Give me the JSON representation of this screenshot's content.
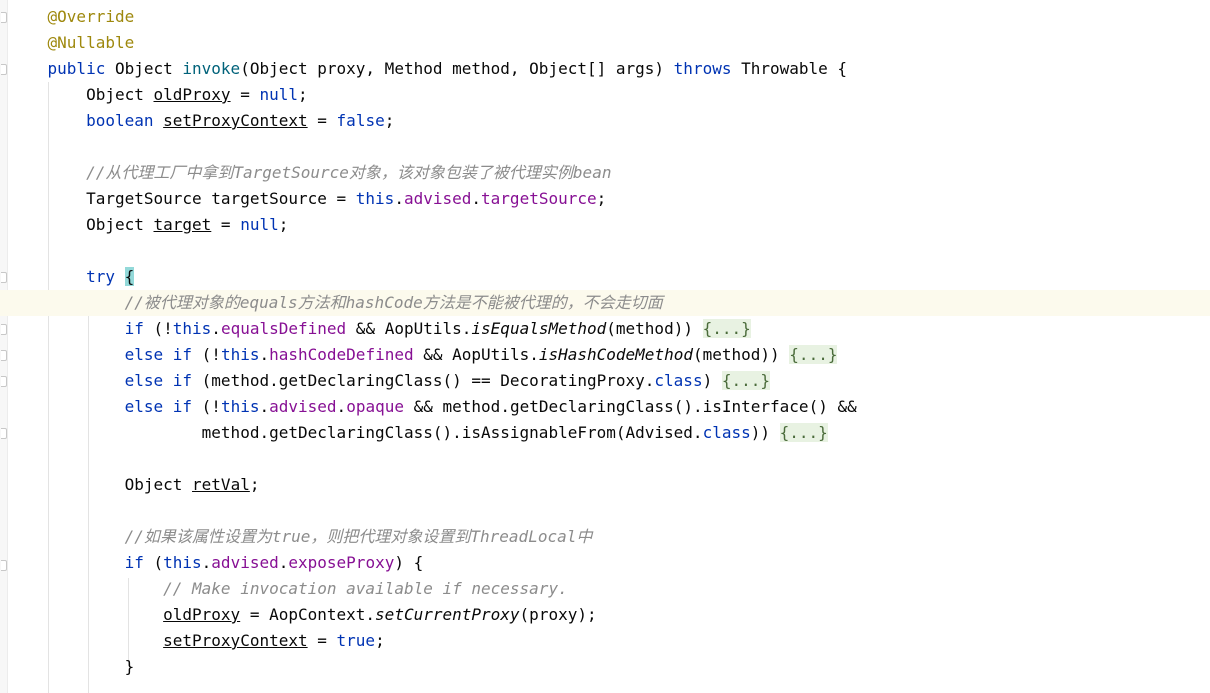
{
  "editor": {
    "lines": [
      [
        {
          "t": "    ",
          "c": ""
        },
        {
          "t": "@Override",
          "c": "ann"
        }
      ],
      [
        {
          "t": "    ",
          "c": ""
        },
        {
          "t": "@Nullable",
          "c": "ann"
        }
      ],
      [
        {
          "t": "    ",
          "c": ""
        },
        {
          "t": "public",
          "c": "kw"
        },
        {
          "t": " Object ",
          "c": ""
        },
        {
          "t": "invoke",
          "c": "fn"
        },
        {
          "t": "(Object proxy, Method method, Object[] args) ",
          "c": ""
        },
        {
          "t": "throws",
          "c": "kw"
        },
        {
          "t": " Throwable {",
          "c": ""
        }
      ],
      [
        {
          "t": "        Object ",
          "c": ""
        },
        {
          "t": "oldProxy",
          "c": "ul"
        },
        {
          "t": " = ",
          "c": ""
        },
        {
          "t": "null",
          "c": "kw"
        },
        {
          "t": ";",
          "c": ""
        }
      ],
      [
        {
          "t": "        ",
          "c": ""
        },
        {
          "t": "boolean",
          "c": "kw"
        },
        {
          "t": " ",
          "c": ""
        },
        {
          "t": "setProxyContext",
          "c": "ul"
        },
        {
          "t": " = ",
          "c": ""
        },
        {
          "t": "false",
          "c": "kw"
        },
        {
          "t": ";",
          "c": ""
        }
      ],
      [],
      [
        {
          "t": "        ",
          "c": ""
        },
        {
          "t": "//从代理工厂中拿到TargetSource对象，该对象包装了被代理实例bean",
          "c": "cm"
        }
      ],
      [
        {
          "t": "        TargetSource targetSource = ",
          "c": ""
        },
        {
          "t": "this",
          "c": "kw"
        },
        {
          "t": ".",
          "c": ""
        },
        {
          "t": "advised",
          "c": "fld"
        },
        {
          "t": ".",
          "c": ""
        },
        {
          "t": "targetSource",
          "c": "fld"
        },
        {
          "t": ";",
          "c": ""
        }
      ],
      [
        {
          "t": "        Object ",
          "c": ""
        },
        {
          "t": "target",
          "c": "ul"
        },
        {
          "t": " = ",
          "c": ""
        },
        {
          "t": "null",
          "c": "kw"
        },
        {
          "t": ";",
          "c": ""
        }
      ],
      [],
      [
        {
          "t": "        ",
          "c": ""
        },
        {
          "t": "try",
          "c": "kw"
        },
        {
          "t": " ",
          "c": ""
        },
        {
          "t": "{",
          "c": "brace-hl"
        }
      ],
      [
        {
          "t": "            ",
          "c": ""
        },
        {
          "t": "//被代理对象的equals方法和hashCode方法是不能被代理的，不会走切面",
          "c": "cm"
        }
      ],
      [
        {
          "t": "            ",
          "c": ""
        },
        {
          "t": "if",
          "c": "kw"
        },
        {
          "t": " (!",
          "c": ""
        },
        {
          "t": "this",
          "c": "kw"
        },
        {
          "t": ".",
          "c": ""
        },
        {
          "t": "equalsDefined",
          "c": "fld"
        },
        {
          "t": " && AopUtils.",
          "c": ""
        },
        {
          "t": "isEqualsMethod",
          "c": "st"
        },
        {
          "t": "(method)) ",
          "c": ""
        },
        {
          "t": "{...}",
          "c": "folded"
        }
      ],
      [
        {
          "t": "            ",
          "c": ""
        },
        {
          "t": "else if",
          "c": "kw"
        },
        {
          "t": " (!",
          "c": ""
        },
        {
          "t": "this",
          "c": "kw"
        },
        {
          "t": ".",
          "c": ""
        },
        {
          "t": "hashCodeDefined",
          "c": "fld"
        },
        {
          "t": " && AopUtils.",
          "c": ""
        },
        {
          "t": "isHashCodeMethod",
          "c": "st"
        },
        {
          "t": "(method)) ",
          "c": ""
        },
        {
          "t": "{...}",
          "c": "folded"
        }
      ],
      [
        {
          "t": "            ",
          "c": ""
        },
        {
          "t": "else if",
          "c": "kw"
        },
        {
          "t": " (method.getDeclaringClass() == DecoratingProxy.",
          "c": ""
        },
        {
          "t": "class",
          "c": "kw"
        },
        {
          "t": ") ",
          "c": ""
        },
        {
          "t": "{...}",
          "c": "folded"
        }
      ],
      [
        {
          "t": "            ",
          "c": ""
        },
        {
          "t": "else if",
          "c": "kw"
        },
        {
          "t": " (!",
          "c": ""
        },
        {
          "t": "this",
          "c": "kw"
        },
        {
          "t": ".",
          "c": ""
        },
        {
          "t": "advised",
          "c": "fld"
        },
        {
          "t": ".",
          "c": ""
        },
        {
          "t": "opaque",
          "c": "fld"
        },
        {
          "t": " && method.getDeclaringClass().isInterface() &&",
          "c": ""
        }
      ],
      [
        {
          "t": "                    method.getDeclaringClass().isAssignableFrom(Advised.",
          "c": ""
        },
        {
          "t": "class",
          "c": "kw"
        },
        {
          "t": ")) ",
          "c": ""
        },
        {
          "t": "{...}",
          "c": "folded"
        }
      ],
      [],
      [
        {
          "t": "            Object ",
          "c": ""
        },
        {
          "t": "retVal",
          "c": "ul"
        },
        {
          "t": ";",
          "c": ""
        }
      ],
      [],
      [
        {
          "t": "            ",
          "c": ""
        },
        {
          "t": "//如果该属性设置为true，则把代理对象设置到ThreadLocal中",
          "c": "cm"
        }
      ],
      [
        {
          "t": "            ",
          "c": ""
        },
        {
          "t": "if",
          "c": "kw"
        },
        {
          "t": " (",
          "c": ""
        },
        {
          "t": "this",
          "c": "kw"
        },
        {
          "t": ".",
          "c": ""
        },
        {
          "t": "advised",
          "c": "fld"
        },
        {
          "t": ".",
          "c": ""
        },
        {
          "t": "exposeProxy",
          "c": "fld"
        },
        {
          "t": ") {",
          "c": ""
        }
      ],
      [
        {
          "t": "                ",
          "c": ""
        },
        {
          "t": "// Make invocation available if necessary.",
          "c": "cm"
        }
      ],
      [
        {
          "t": "                ",
          "c": ""
        },
        {
          "t": "oldProxy",
          "c": "ul"
        },
        {
          "t": " = AopContext.",
          "c": ""
        },
        {
          "t": "setCurrentProxy",
          "c": "st"
        },
        {
          "t": "(proxy);",
          "c": ""
        }
      ],
      [
        {
          "t": "                ",
          "c": ""
        },
        {
          "t": "setProxyContext",
          "c": "ul"
        },
        {
          "t": " = ",
          "c": ""
        },
        {
          "t": "true",
          "c": "kw"
        },
        {
          "t": ";",
          "c": ""
        }
      ],
      [
        {
          "t": "            }",
          "c": ""
        }
      ]
    ],
    "caret_line": 11,
    "colors": {
      "keyword": "#0033b3",
      "annotation": "#9e880d",
      "method_decl": "#00627a",
      "field": "#871094",
      "comment": "#8c8c8c",
      "caret_line_bg": "#fcfaed",
      "folded_bg": "#e8f2e2",
      "brace_match_bg": "#93d9d9"
    }
  }
}
